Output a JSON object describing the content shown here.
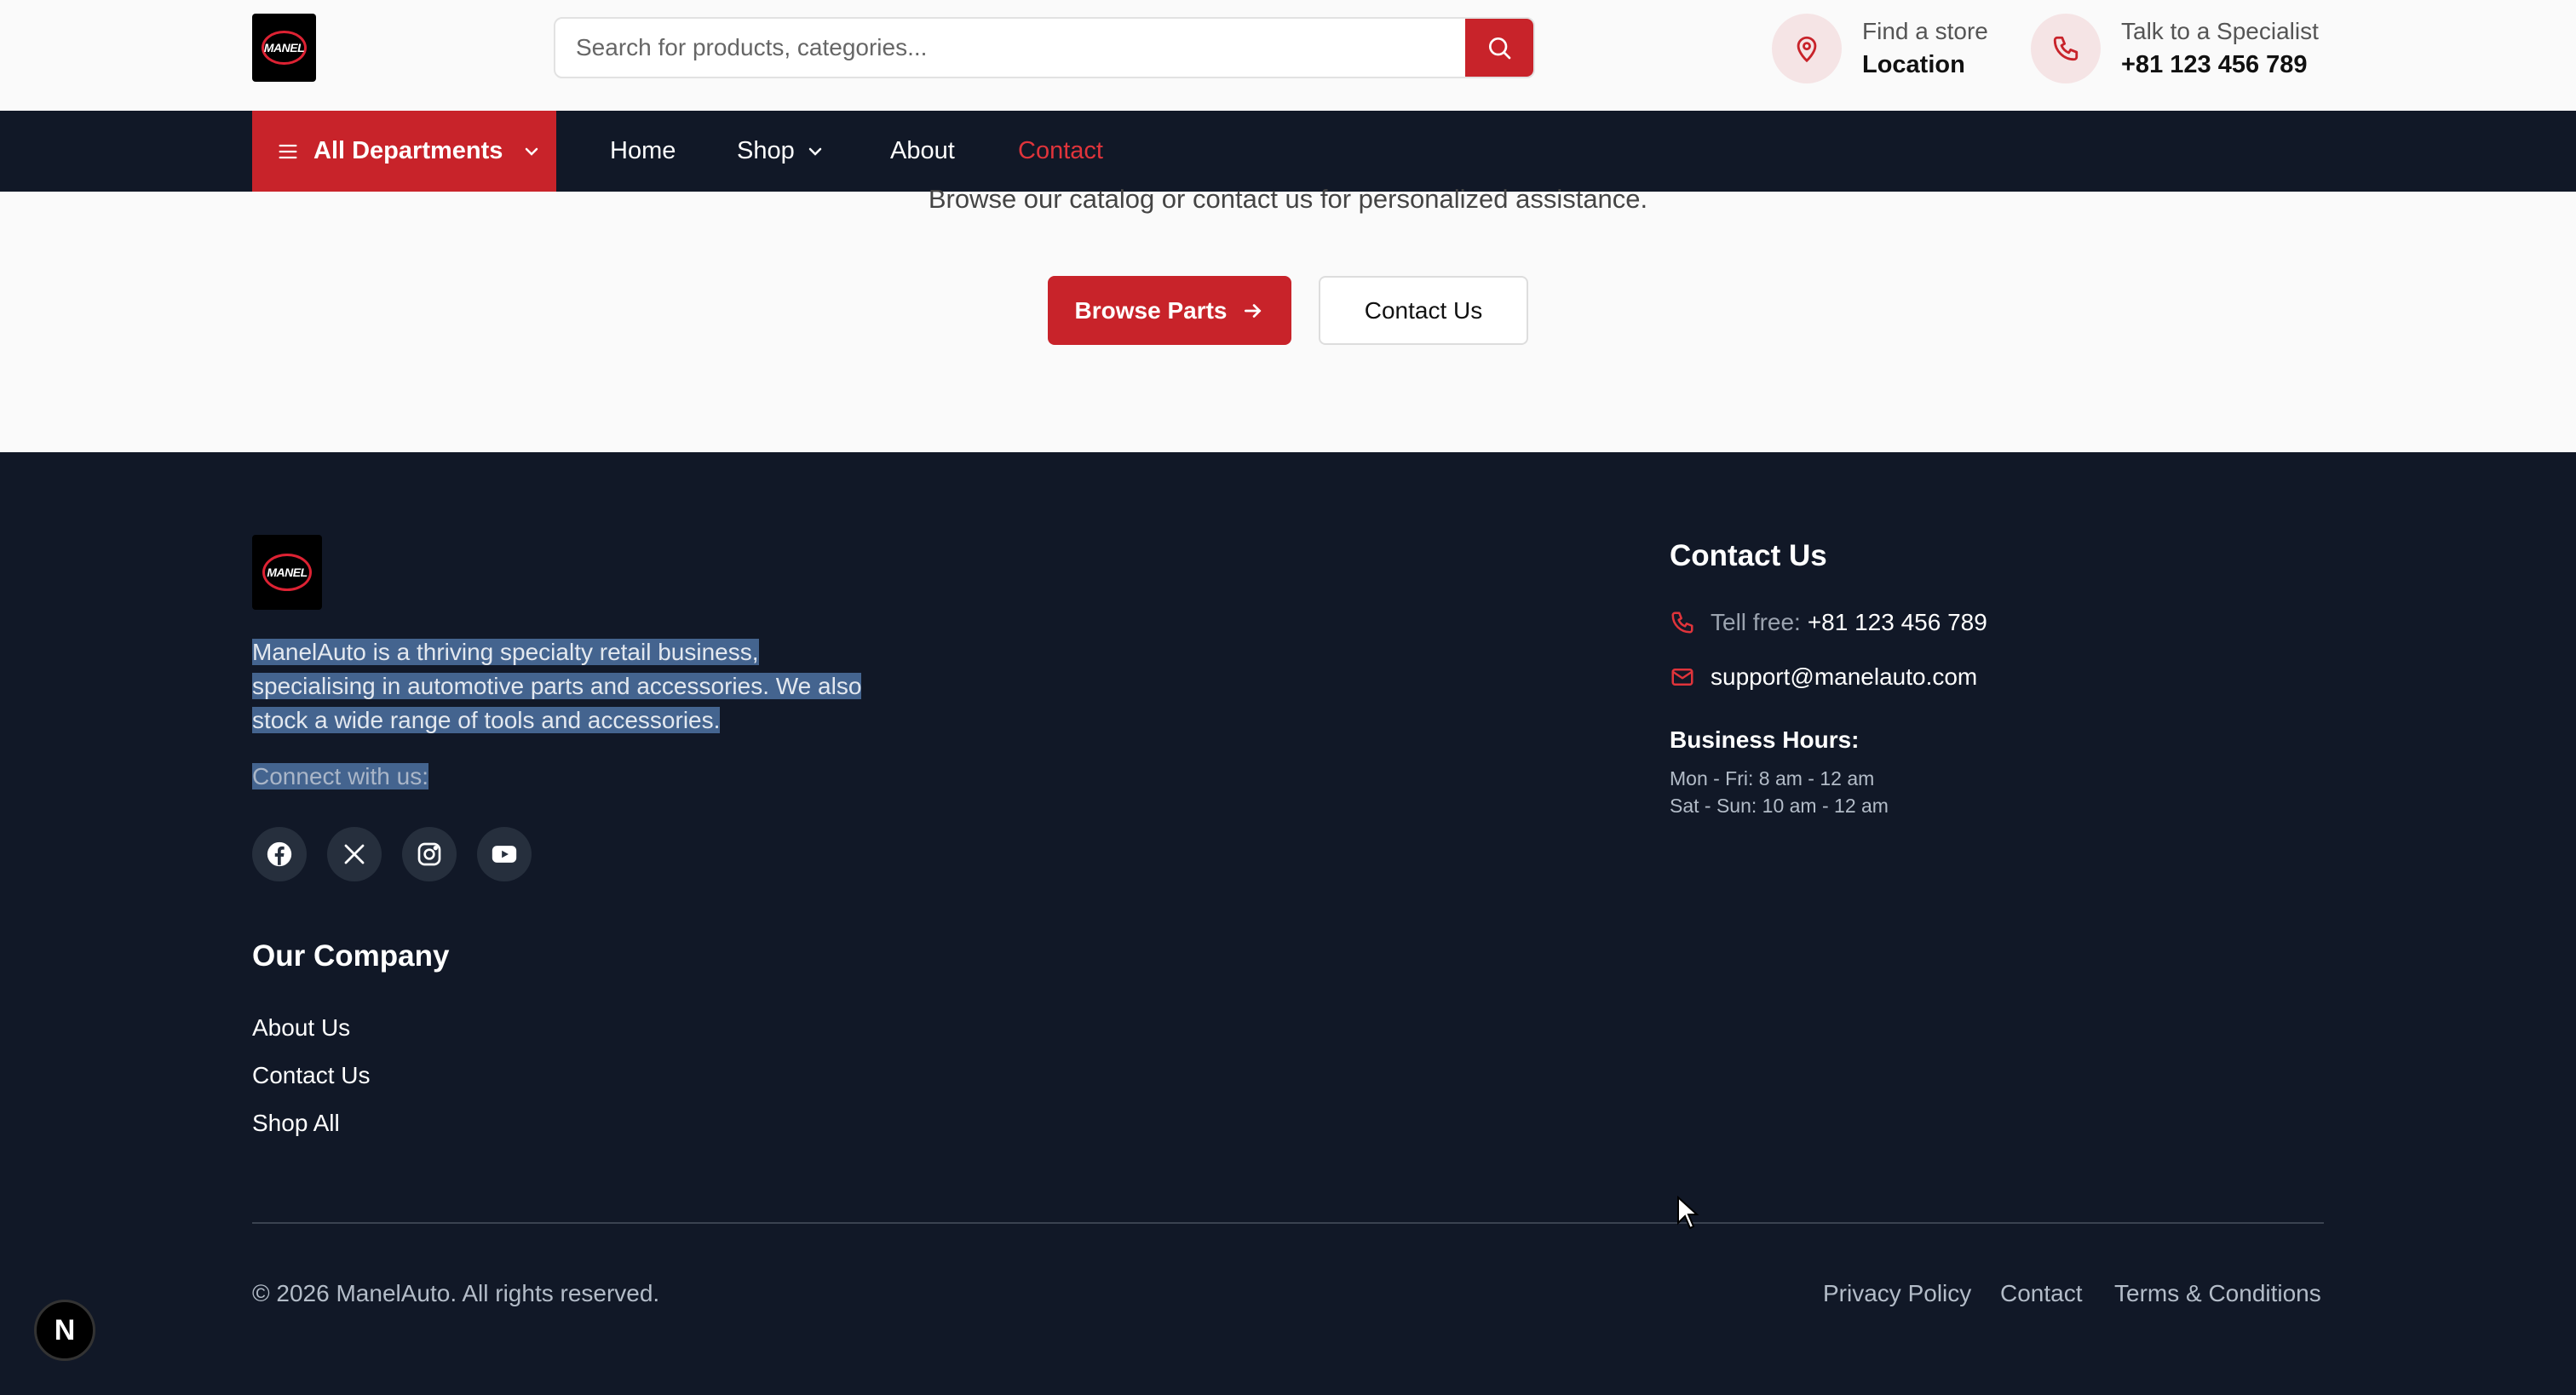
{
  "header": {
    "logo_text": "MANEL",
    "search": {
      "placeholder": "Search for products, categories..."
    },
    "store": {
      "label": "Find a store",
      "value": "Location"
    },
    "specialist": {
      "label": "Talk to a Specialist",
      "value": "+81 123 456 789"
    }
  },
  "nav": {
    "departments_label": "All Departments",
    "links": {
      "home": "Home",
      "shop": "Shop",
      "about": "About",
      "contact": "Contact"
    }
  },
  "hero": {
    "subtitle": "Browse our catalog or contact us for personalized assistance.",
    "browse_label": "Browse Parts",
    "contact_label": "Contact Us"
  },
  "footer": {
    "about_line1": "ManelAuto is a thriving specialty retail business,",
    "about_line2": "specialising in automotive parts and accessories. We also",
    "about_line3": "stock a wide range of tools and accessories.",
    "connect_label": "Connect with us:",
    "social": [
      "facebook-icon",
      "x-icon",
      "instagram-icon",
      "youtube-icon"
    ],
    "company_heading": "Our Company",
    "company_links": [
      "About Us",
      "Contact Us",
      "Shop All"
    ],
    "contact_heading": "Contact Us",
    "phone_label": "Tell free:",
    "phone_value": "+81 123 456 789",
    "email": "support@manelauto.com",
    "hours_title": "Business Hours:",
    "hours_weekday": "Mon - Fri: 8 am - 12 am",
    "hours_weekend": "Sat - Sun: 10 am - 12 am",
    "copyright": "© 2026 ManelAuto. All rights reserved.",
    "legal_links": [
      "Privacy Policy",
      "Contact",
      "Terms & Conditions"
    ]
  },
  "dev_badge": "N",
  "colors": {
    "accent": "#c8232a",
    "dark": "#111827",
    "selection": "#44648f"
  }
}
